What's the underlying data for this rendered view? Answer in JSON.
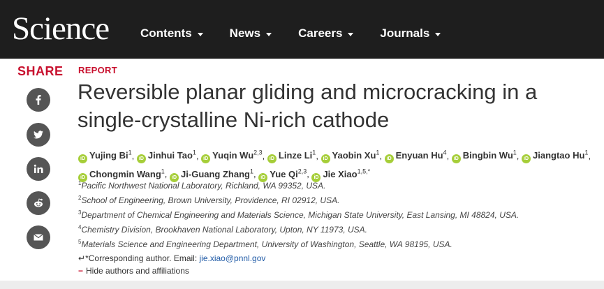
{
  "header": {
    "logo": "Science",
    "nav": [
      "Contents",
      "News",
      "Careers",
      "Journals"
    ]
  },
  "share": {
    "label": "SHARE",
    "buttons": [
      "facebook-icon",
      "twitter-icon",
      "linkedin-icon",
      "reddit-icon",
      "email-icon"
    ]
  },
  "article": {
    "type": "REPORT",
    "title": "Reversible planar gliding and microcracking in a single-crystalline Ni-rich cathode",
    "authors": [
      {
        "name": "Yujing Bi",
        "sup": "1"
      },
      {
        "name": "Jinhui Tao",
        "sup": "1"
      },
      {
        "name": "Yuqin Wu",
        "sup": "2,3"
      },
      {
        "name": "Linze Li",
        "sup": "1"
      },
      {
        "name": "Yaobin Xu",
        "sup": "1"
      },
      {
        "name": "Enyuan Hu",
        "sup": "4"
      },
      {
        "name": "Bingbin Wu",
        "sup": "1"
      },
      {
        "name": "Jiangtao Hu",
        "sup": "1"
      },
      {
        "name": "Chongmin Wang",
        "sup": "1"
      },
      {
        "name": "Ji-Guang Zhang",
        "sup": "1"
      },
      {
        "name": "Yue Qi",
        "sup": "2,3"
      },
      {
        "name": "Jie Xiao",
        "sup": "1,5,*"
      }
    ],
    "affiliations": [
      {
        "sup": "1",
        "text": "Pacific Northwest National Laboratory, Richland, WA 99352, USA."
      },
      {
        "sup": "2",
        "text": "School of Engineering, Brown University, Providence, RI 02912, USA."
      },
      {
        "sup": "3",
        "text": "Department of Chemical Engineering and Materials Science, Michigan State University, East Lansing, MI 48824, USA."
      },
      {
        "sup": "4",
        "text": "Chemistry Division, Brookhaven National Laboratory, Upton, NY 11973, USA."
      },
      {
        "sup": "5",
        "text": "Materials Science and Engineering Department, University of Washington, Seattle, WA 98195, USA."
      }
    ],
    "corresponding_prefix": "*Corresponding author. Email: ",
    "corresponding_email": "jie.xiao@pnnl.gov",
    "hide_label": "Hide authors and affiliations"
  },
  "colors": {
    "brand_red": "#c8102e",
    "orcid_green": "#a6ce39",
    "nav_bg": "#1e1e1e",
    "link_blue": "#1f5aa6"
  }
}
